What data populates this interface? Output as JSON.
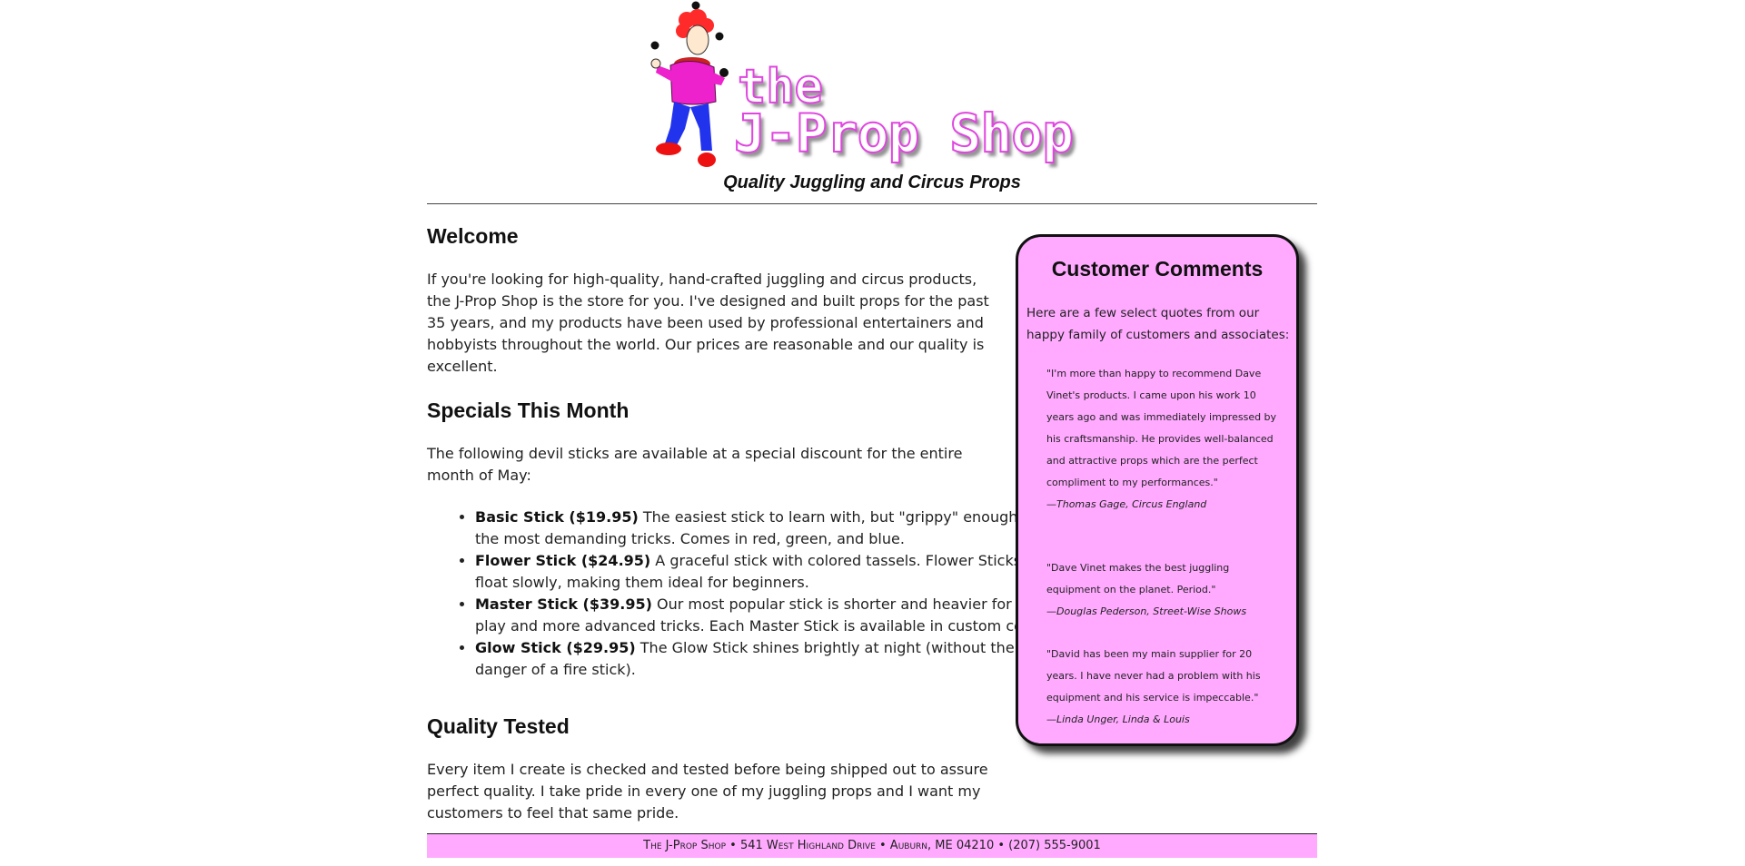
{
  "header": {
    "logo": {
      "line1": "the",
      "line2": "J-Prop Shop",
      "figure_icon": "juggling-clown-icon"
    },
    "tagline": "Quality Juggling and Circus Props"
  },
  "main": {
    "welcome": {
      "heading": "Welcome",
      "text": "If you're looking for high-quality, hand-crafted juggling and circus products, the J-Prop Shop is the store for you. I've designed and built props for the past 35 years, and my products have been used by professional entertainers and hobbyists throughout the world. Our prices are reasonable and our quality is excellent."
    },
    "specials": {
      "heading": "Specials This Month",
      "intro": "The following devil sticks are available at a special discount for the entire month of May:",
      "items": [
        {
          "name": "Basic Stick ($19.95)",
          "desc": " The easiest stick to learn with, but \"grippy\" enough for the most demanding tricks. Comes in red, green, and blue."
        },
        {
          "name": "Flower Stick ($24.95)",
          "desc": " A graceful stick with colored tassels. Flower Sticks float slowly, making them ideal for beginners."
        },
        {
          "name": "Master Stick ($39.95)",
          "desc": " Our most popular stick is shorter and heavier for fast play and more advanced tricks. Each Master Stick is available in custom colors."
        },
        {
          "name": "Glow Stick ($29.95)",
          "desc": " The Glow Stick shines brightly at night (without the danger of a fire stick)."
        }
      ]
    },
    "quality": {
      "heading": "Quality Tested",
      "text": "Every item I create is checked and tested before being shipped out to assure perfect quality. I take pride in every one of my juggling props and I want my customers to feel that same pride."
    }
  },
  "sidebar": {
    "title": "Customer Comments",
    "intro": "Here are a few select quotes from our happy family of customers and associates:",
    "quotes": [
      {
        "text": "\"I'm more than happy to recommend Dave Vinet's products. I came upon his work 10 years ago and was immediately impressed by his craftsmanship. He provides well-balanced and attractive props which are the perfect compliment to my performances.\"",
        "author": "—Thomas Gage, Circus England"
      },
      {
        "text": "\"Dave Vinet makes the best juggling equipment on the planet. Period.\"",
        "author": "—Douglas Pederson, Street-Wise Shows"
      },
      {
        "text": "\"David has been my main supplier for 20 years. I have never had a problem with his equipment and his service is impeccable.\"",
        "author": "—Linda Unger, Linda & Louis"
      }
    ]
  },
  "footer": {
    "text": "The J-Prop Shop • 541 West Highland Drive • Auburn, ME 04210 • (207) 555-9001"
  },
  "colors": {
    "accent_pink": "#ffaaff",
    "logo_magenta": "#e046e0",
    "text": "#222222"
  }
}
